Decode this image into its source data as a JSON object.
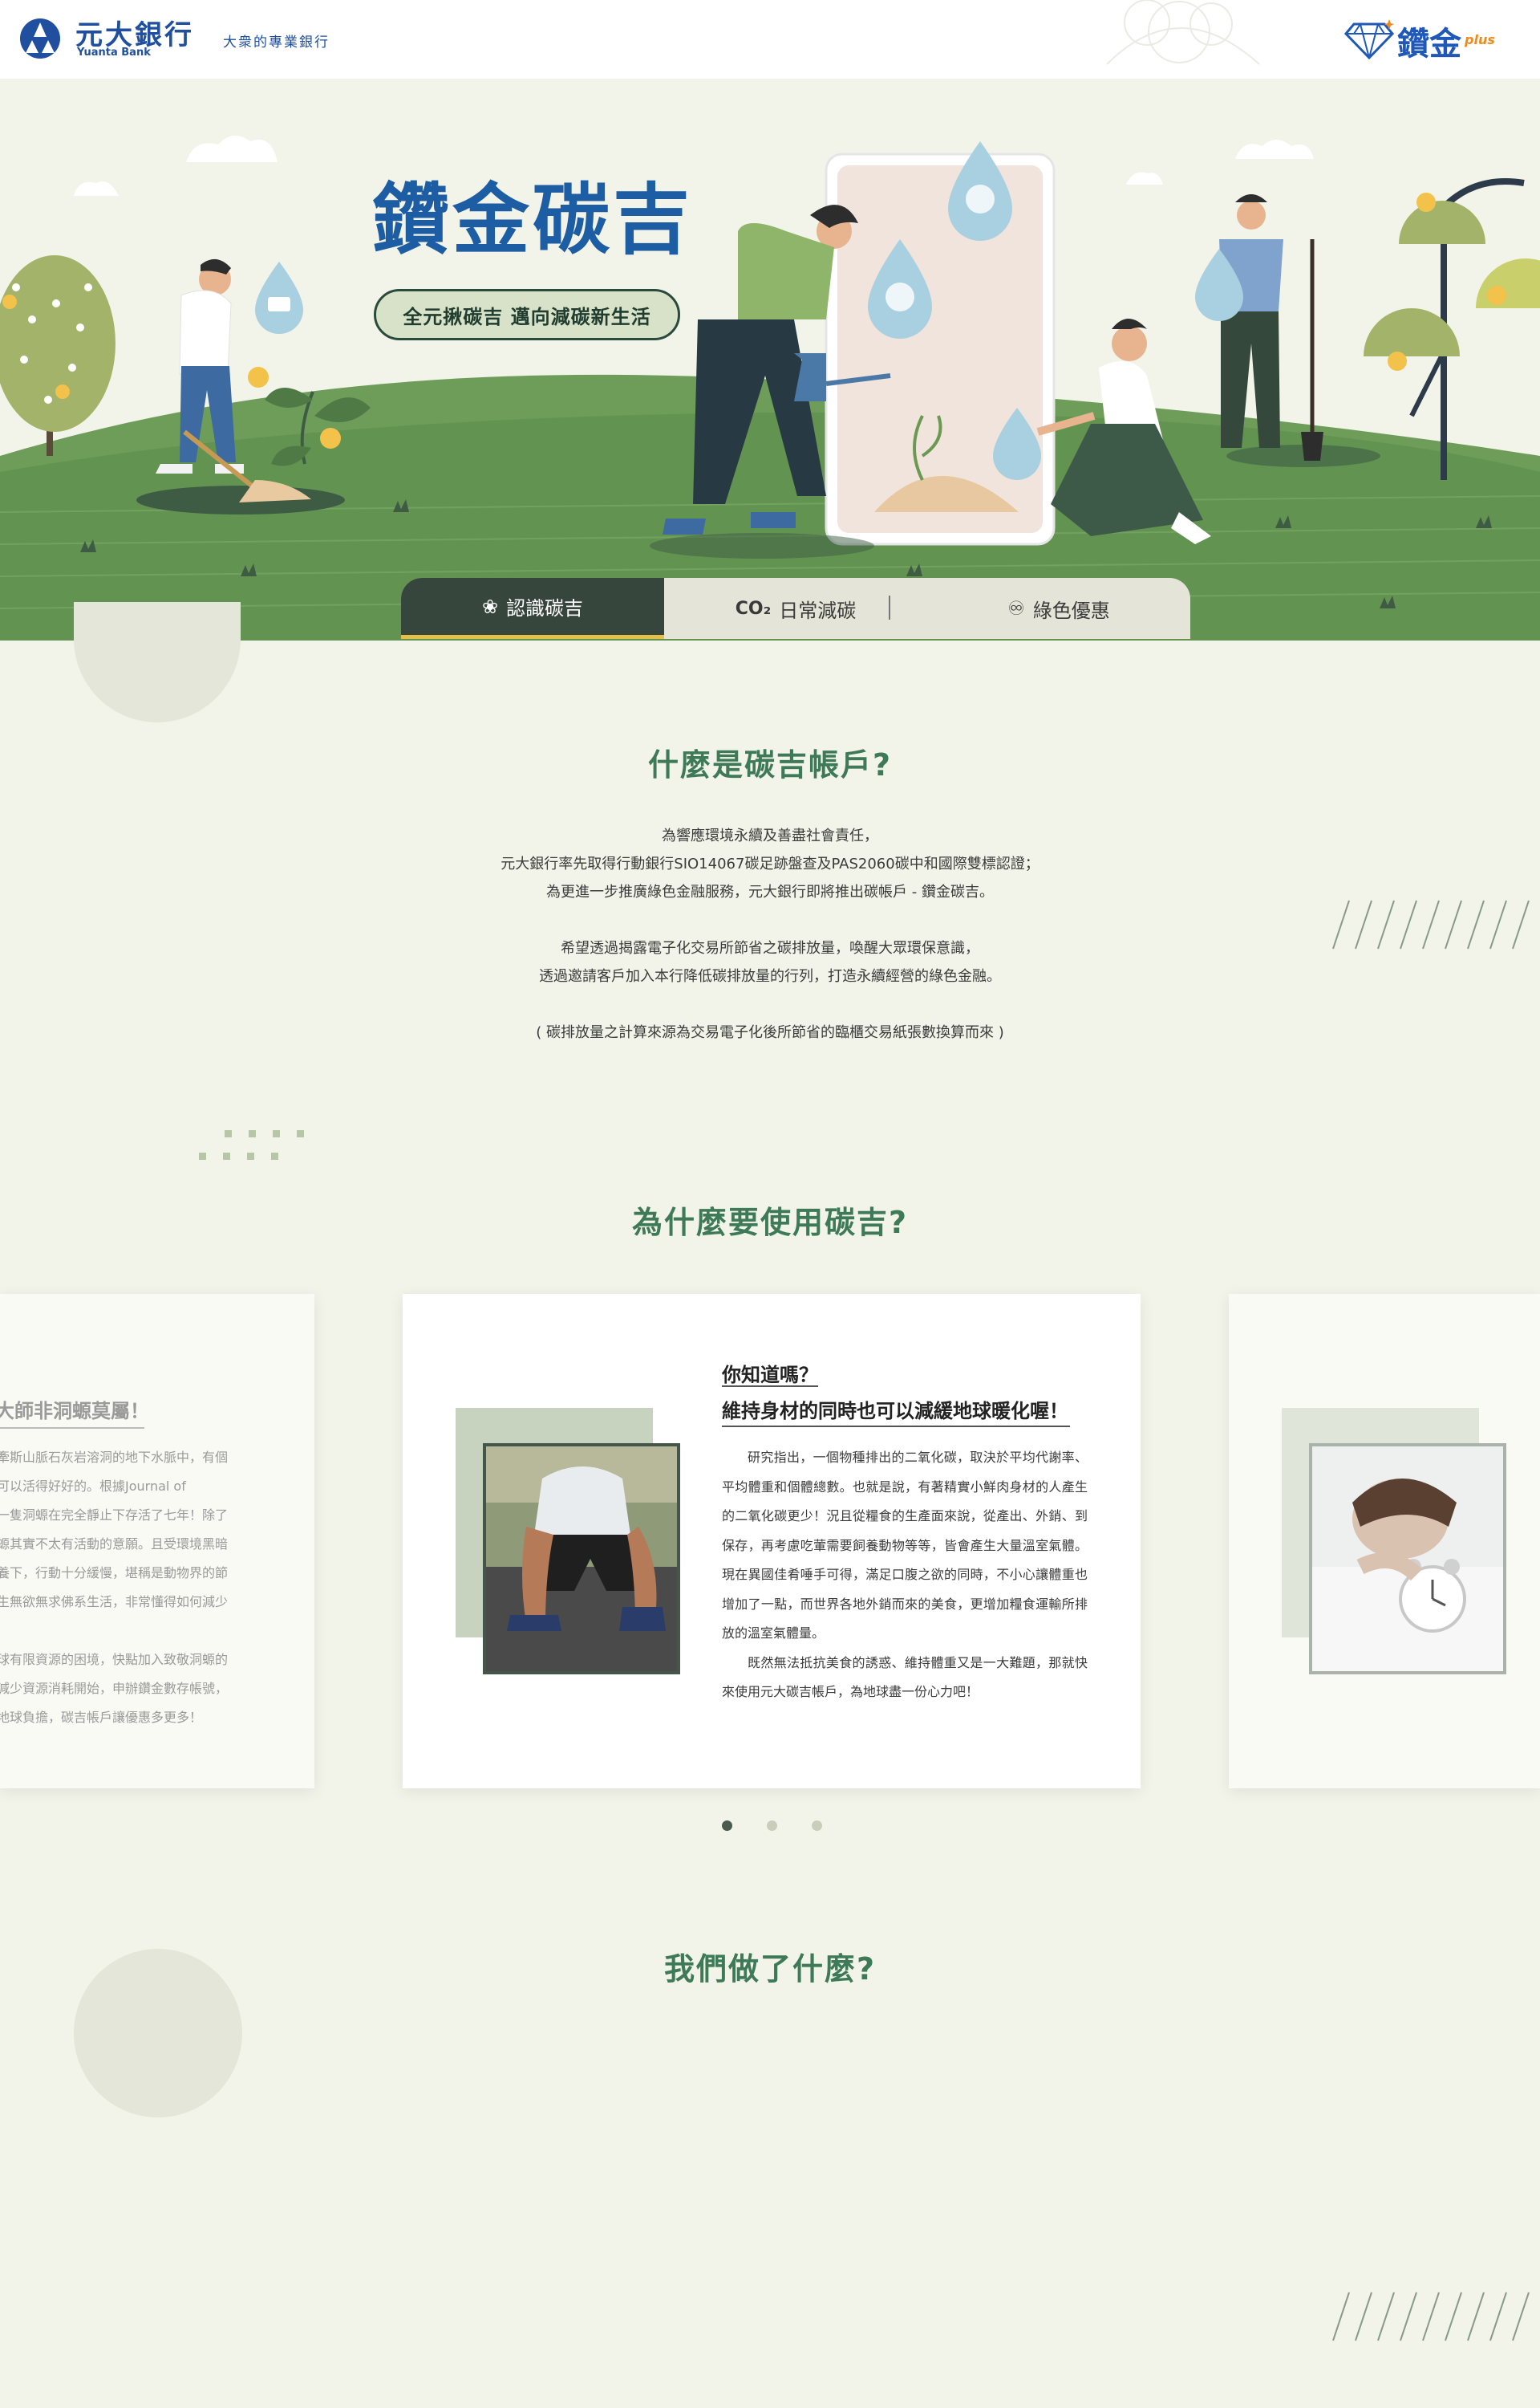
{
  "header": {
    "bank_name": "元大銀行",
    "bank_name_en": "Yuanta Bank",
    "tagline": "大衆的專業銀行",
    "partner_logo_text": "鑽金",
    "partner_logo_plus": "plus"
  },
  "hero": {
    "title": "鑽金碳吉",
    "slogan": "全元揪碳吉 邁向減碳新生活"
  },
  "tabs": [
    {
      "label": "認識碳吉",
      "icon": "leaf-icon",
      "active": true
    },
    {
      "label": "日常減碳",
      "icon": "co2-icon",
      "active": false
    },
    {
      "label": "綠色優惠",
      "icon": "discount-icon",
      "active": false
    }
  ],
  "about": {
    "title": "什麼是碳吉帳戶?",
    "lines": [
      "為響應環境永續及善盡社會責任，",
      "元大銀行率先取得行動銀行SIO14067碳足跡盤查及PAS2060碳中和國際雙標認證；",
      "為更進一步推廣綠色金融服務，元大銀行即將推出碳帳戶 - 鑽金碳吉。",
      "希望透過揭露電子化交易所節省之碳排放量，喚醒大眾環保意識，",
      "透過邀請客戶加入本行降低碳排放量的行列，打造永續經營的綠色金融。",
      "( 碳排放量之計算來源為交易電子化後所節省的臨櫃交易紙張數換算而來 )"
    ]
  },
  "why": {
    "title": "為什麼要使用碳吉?",
    "current_card": {
      "question": "你知道嗎？",
      "heading": "維持身材的同時也可以減緩地球暖化喔！",
      "paragraphs": [
        "研究指出，一個物種排出的二氧化碳，取決於平均代謝率、平均體重和個體總數。也就是說，有著精實小鮮肉身材的人產生的二氧化碳更少！況且從糧食的生產面來說，從產出、外銷、到保存，再考慮吃葷需要飼養動物等等，皆會產生大量溫室氣體。現在異國佳肴唾手可得，滿足口腹之欲的同時，不小心讓體重也增加了一點，而世界各地外銷而來的美食，更增加糧食運輸所排放的溫室氣體量。",
        "既然無法抵抗美食的誘惑、維持體重又是一大難題，那就快來使用元大碳吉帳戶，為地球盡一份心力吧！"
      ]
    },
    "prev_card": {
      "heading": "大師非洞螈莫屬！",
      "lines": [
        "牽斯山脈石灰岩溶洞的地下水脈中，有個",
        "可以活得好好的。根據Journal of",
        "一隻洞螈在完全靜止下存活了七年！除了",
        "螈其實不太有活動的意願。且受環境黑暗",
        "養下，行動十分緩慢，堪稱是動物界的節",
        "生無欲無求佛系生活，非常懂得如何減少",
        "",
        "球有限資源的困境，快點加入致敬洞螈的",
        "減少資源消耗開始，申辦鑽金數存帳號，",
        "地球負擔，碳吉帳戶讓優惠多更多！"
      ]
    },
    "pagination": {
      "total": 3,
      "active": 1
    }
  },
  "what": {
    "title": "我們做了什麼?"
  },
  "colors": {
    "page_bg": "#f2f4ea",
    "brand_blue": "#1d5da3",
    "section_green": "#3e7a57",
    "tab_active": "#37463c",
    "tab_accent": "#e2c04a"
  }
}
